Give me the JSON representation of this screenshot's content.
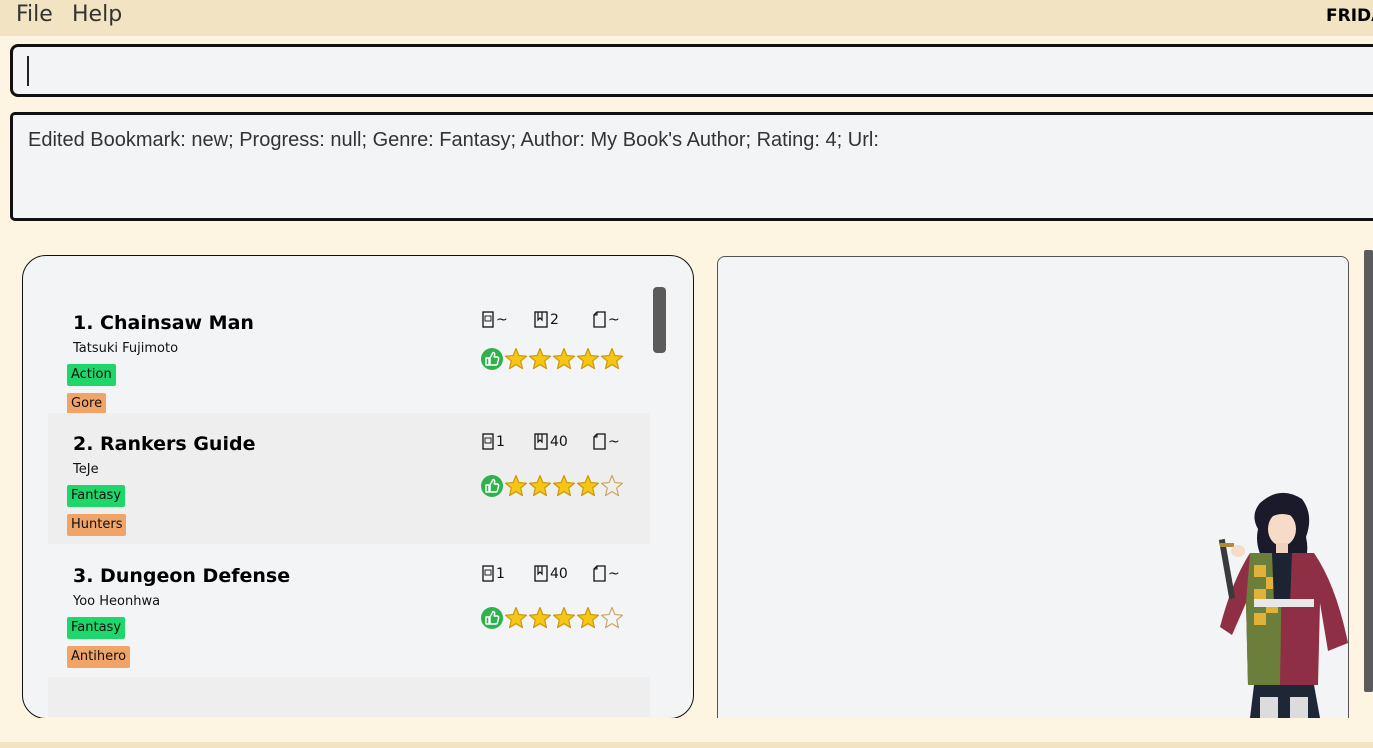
{
  "menu": {
    "file": "File",
    "help": "Help",
    "brand": "FRIDAY"
  },
  "command": {
    "value": "",
    "placeholder": ""
  },
  "result": {
    "text": "Edited Bookmark: new; Progress: null; Genre: Fantasy; Author: My Book's Author; Rating: 4; Url:"
  },
  "bookmarks": [
    {
      "title": "1. Chainsaw Man",
      "author": "Tatsuki Fujimoto",
      "genre": "Action",
      "tag": "Gore",
      "volume": "~",
      "chapter": "2",
      "page": "~",
      "rating": 5
    },
    {
      "title": "2. Rankers Guide",
      "author": "TeJe",
      "genre": "Fantasy",
      "tag": "Hunters",
      "volume": "1",
      "chapter": "40",
      "page": "~",
      "rating": 4
    },
    {
      "title": "3. Dungeon Defense",
      "author": "Yoo Heonhwa",
      "genre": "Fantasy",
      "tag": "Antihero",
      "volume": "1",
      "chapter": "40",
      "page": "~",
      "rating": 4
    }
  ],
  "colors": {
    "genre": "#1fd66b",
    "tag": "#f0a468",
    "star": "#f5c518",
    "thumb": "#2fb24c",
    "background": "#fdf5e2"
  }
}
